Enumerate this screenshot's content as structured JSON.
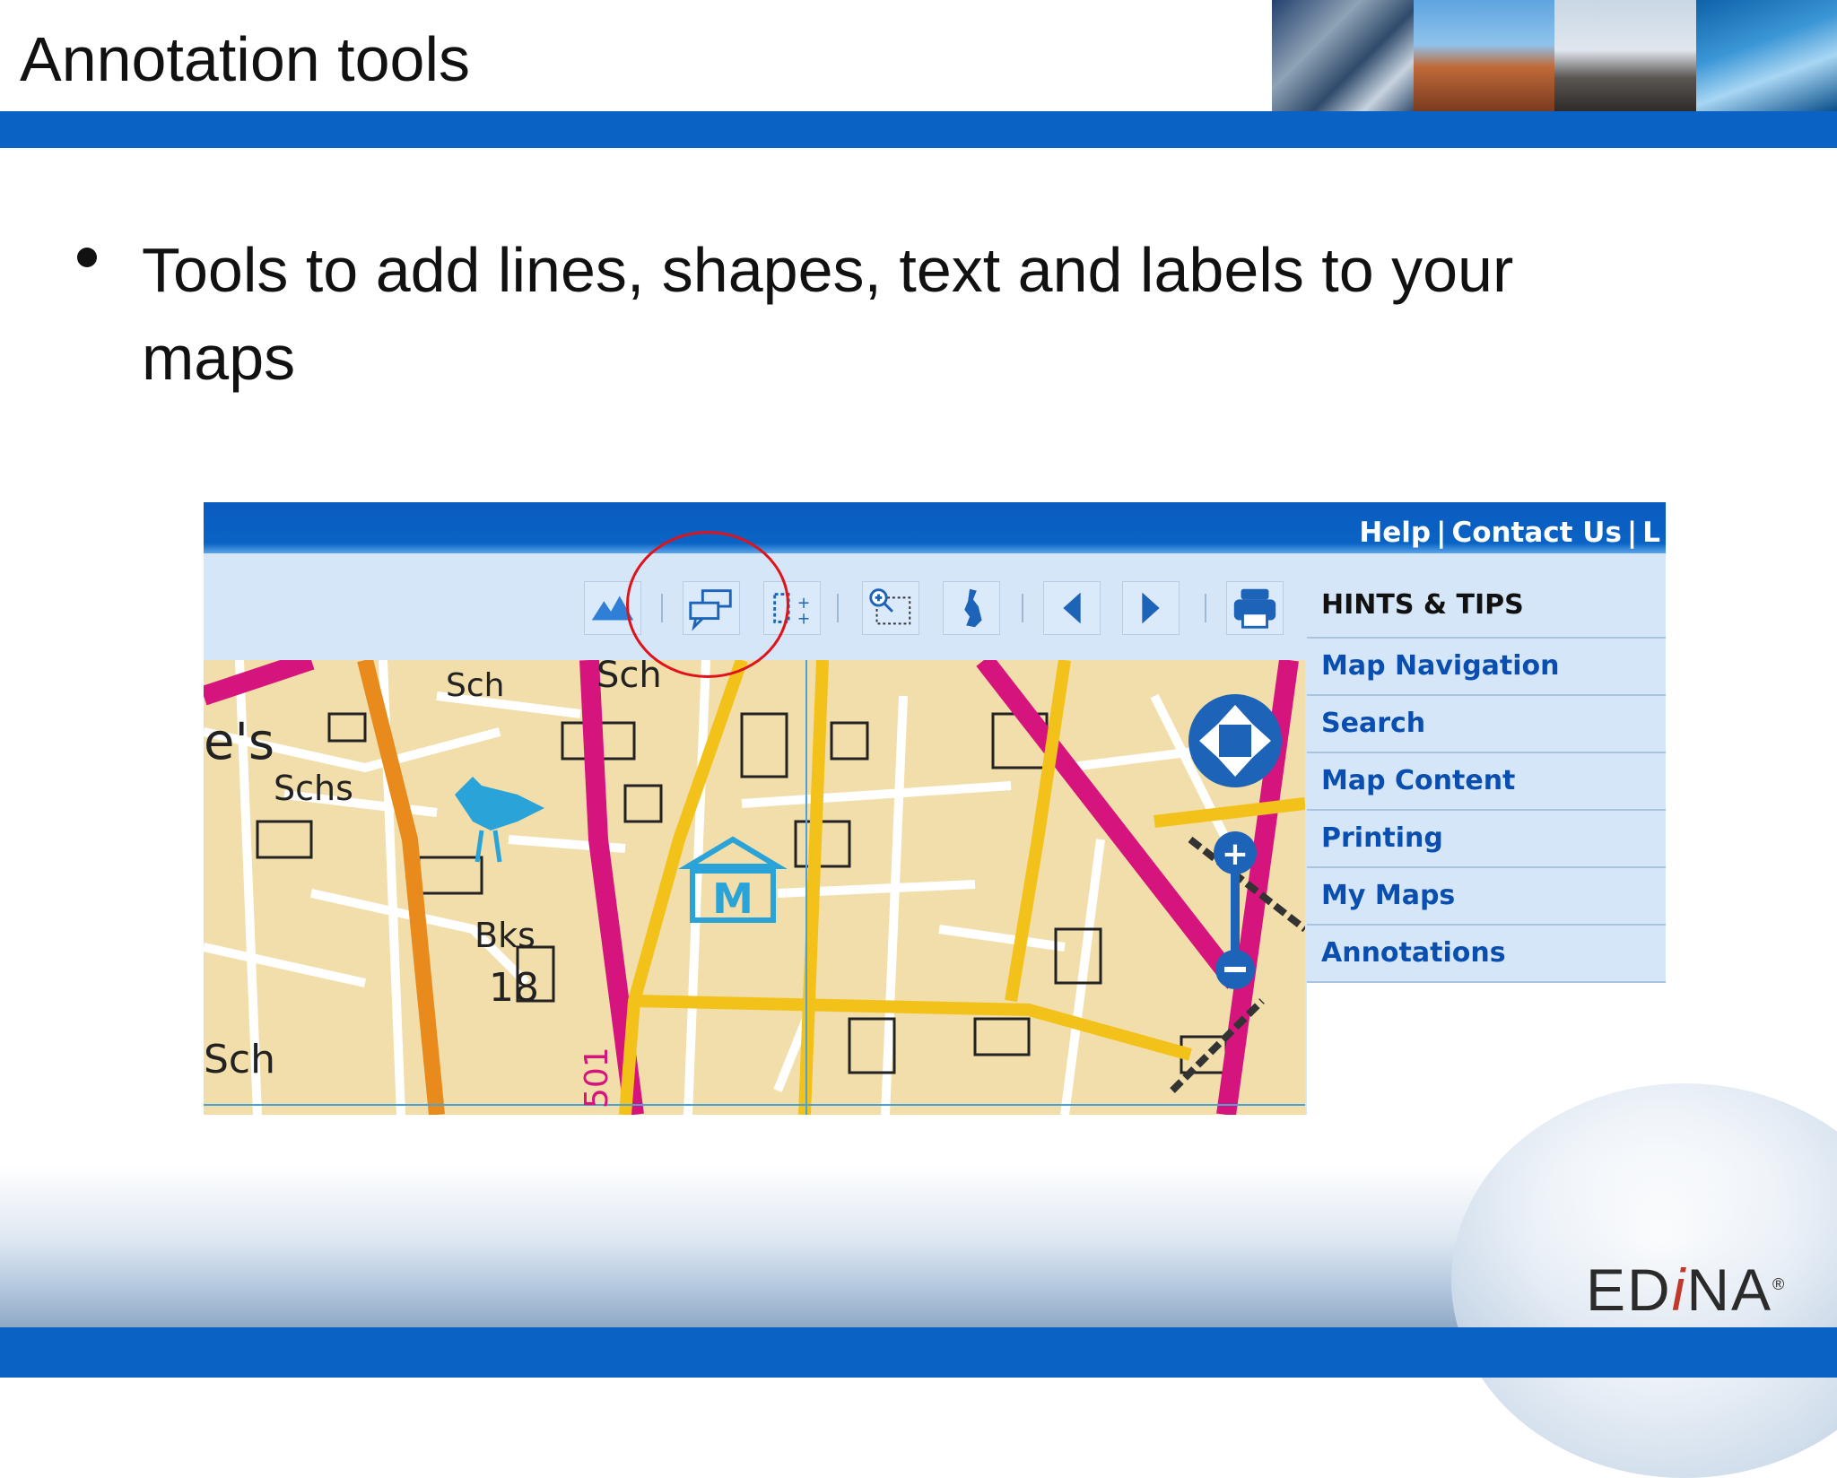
{
  "slide": {
    "title": "Annotation tools",
    "bullet": "Tools to add lines, shapes, text and labels to your maps"
  },
  "screenshot": {
    "top_links": [
      "Help",
      "Contact Us",
      "L"
    ],
    "toolbar_icons": [
      "mountain-icon",
      "speech-bubbles-icon",
      "dotted-box-icon",
      "zoom-box-icon",
      "uk-map-icon",
      "back-arrow-icon",
      "forward-arrow-icon",
      "print-icon"
    ],
    "hints": {
      "title": "HINTS & TIPS",
      "items": [
        "Map Navigation",
        "Search",
        "Map Content",
        "Printing",
        "My Maps",
        "Annotations"
      ]
    },
    "map_labels": {
      "sch1": "Sch",
      "sch2": "Sch",
      "schs": "Schs",
      "es": "e's",
      "bks": "Bks",
      "num": "18",
      "road": "501",
      "sch3": "Sch"
    }
  },
  "brand": {
    "name_pre": "ED",
    "name_i": "i",
    "name_post": "NA",
    "reg": "®"
  },
  "colors": {
    "accent_blue": "#0a63c4",
    "highlight_circle": "#e0131a",
    "hint_link": "#0a4fb0"
  }
}
